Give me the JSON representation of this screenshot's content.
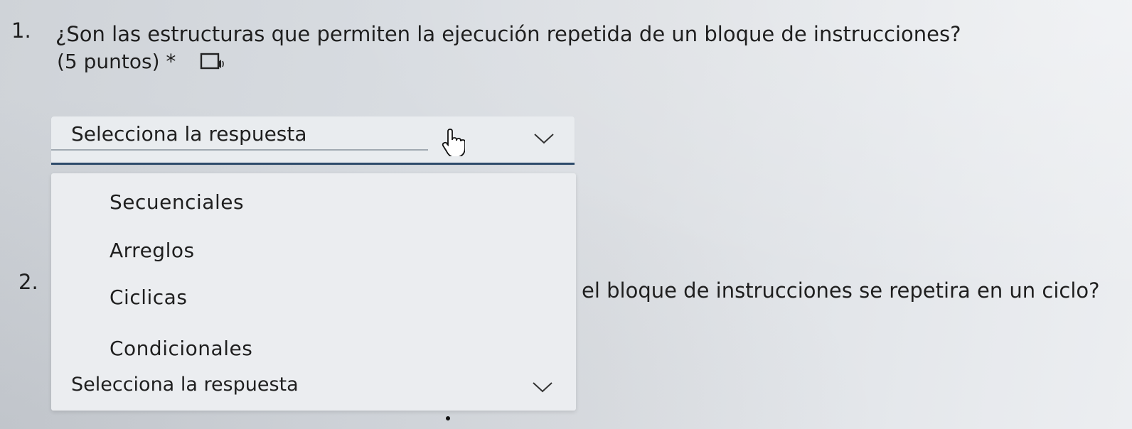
{
  "question1": {
    "number": "1.",
    "text": "¿Son las estructuras que permiten la ejecución repetida de un  bloque de instrucciones?",
    "points": "(5 puntos) *",
    "reader_icon": "immersive-reader-icon"
  },
  "dropdown1": {
    "placeholder": "Selecciona la respuesta",
    "chevron_icon": "chevron-down-icon",
    "options": [
      "Secuenciales",
      "Arreglos",
      "Ciclicas",
      "Condicionales"
    ]
  },
  "question2": {
    "number": "2.",
    "text": "el bloque de instrucciones se repetira en un ciclo?"
  },
  "dropdown2": {
    "placeholder": "Selecciona la respuesta",
    "chevron_icon": "chevron-down-icon"
  },
  "colors": {
    "underline": "#2d4a6a",
    "text": "#1f1f1f",
    "panel": "#ebedf0"
  }
}
